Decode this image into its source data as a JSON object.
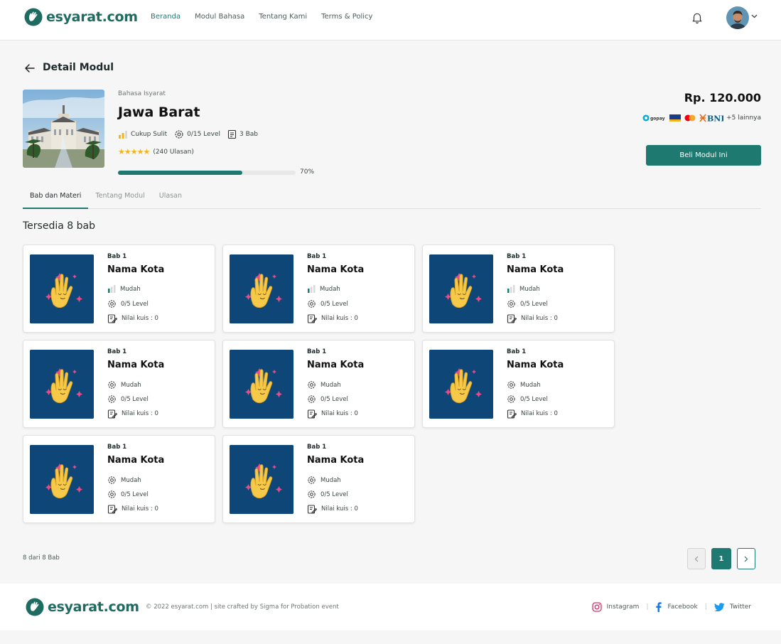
{
  "brand": {
    "name": "esyarat.com",
    "accent": "#1e7a70"
  },
  "nav": {
    "items": [
      {
        "label": "Beranda"
      },
      {
        "label": "Modul Bahasa"
      },
      {
        "label": "Tentang Kami"
      },
      {
        "label": "Terms & Policy"
      }
    ]
  },
  "header": {
    "notification_icon": "bell-icon",
    "avatar_icon": "user-avatar"
  },
  "page": {
    "title": "Detail Modul"
  },
  "module": {
    "category": "Bahasa Isyarat",
    "title": "Jawa Barat",
    "difficulty": "Cukup Sulit",
    "levels": "0/15 Level",
    "chapters": "3 Bab",
    "reviews": "(240 Ulasan)",
    "rating_stars": 5,
    "progress": 0.7,
    "progress_label": "70%",
    "price": "Rp. 120.000",
    "payment_more": "+5 lainnya",
    "buy_label": "Beli Modul Ini"
  },
  "tabs": [
    {
      "label": "Bab dan Materi"
    },
    {
      "label": "Tentang Modul"
    },
    {
      "label": "Ulasan"
    }
  ],
  "section": {
    "title": "Tersedia 8 bab"
  },
  "chapters": [
    {
      "bab": "Bab 1",
      "name": "Nama Kota",
      "difficulty": "Mudah",
      "level": "0/5 Level",
      "quiz": "Nilai kuis : 0",
      "show_bars": true
    },
    {
      "bab": "Bab 1",
      "name": "Nama Kota",
      "difficulty": "Mudah",
      "level": "0/5 Level",
      "quiz": "Nilai kuis : 0",
      "show_bars": true
    },
    {
      "bab": "Bab 1",
      "name": "Nama Kota",
      "difficulty": "Mudah",
      "level": "0/5 Level",
      "quiz": "Nilai kuis : 0",
      "show_bars": true
    },
    {
      "bab": "Bab 1",
      "name": "Nama Kota",
      "difficulty": "Mudah",
      "level": "0/5 Level",
      "quiz": "Nilai kuis : 0",
      "show_bars": false
    },
    {
      "bab": "Bab 1",
      "name": "Nama Kota",
      "difficulty": "Mudah",
      "level": "0/5 Level",
      "quiz": "Nilai kuis : 0",
      "show_bars": false
    },
    {
      "bab": "Bab 1",
      "name": "Nama Kota",
      "difficulty": "Mudah",
      "level": "0/5 Level",
      "quiz": "Nilai kuis : 0",
      "show_bars": false
    },
    {
      "bab": "Bab 1",
      "name": "Nama Kota",
      "difficulty": "Mudah",
      "level": "0/5 Level",
      "quiz": "Nilai kuis : 0",
      "show_bars": false
    },
    {
      "bab": "Bab 1",
      "name": "Nama Kota",
      "difficulty": "Mudah",
      "level": "0/5 Level",
      "quiz": "Nilai kuis : 0",
      "show_bars": false
    }
  ],
  "pagination": {
    "count_label": "8 dari 8 Bab",
    "current": "1"
  },
  "footer": {
    "copyright": "© 2022 esyarat.com | site crafted by Sigma for Probation event",
    "socials": [
      {
        "label": "Instagram",
        "icon": "instagram-icon"
      },
      {
        "label": "Facebook",
        "icon": "facebook-icon"
      },
      {
        "label": "Twitter",
        "icon": "twitter-icon"
      }
    ]
  }
}
